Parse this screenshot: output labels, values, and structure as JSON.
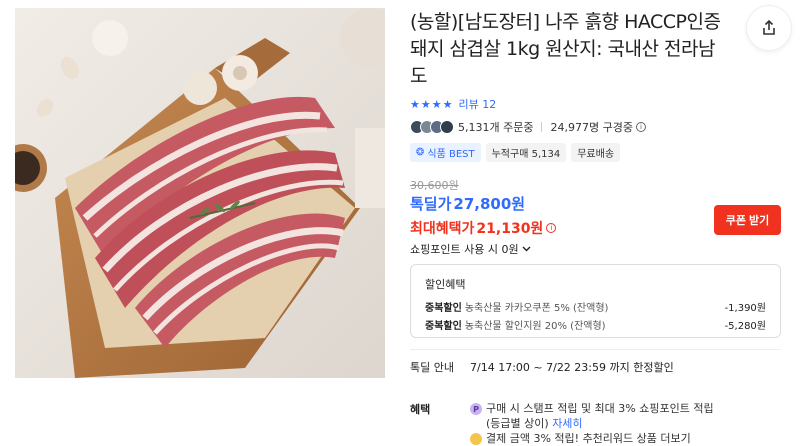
{
  "product": {
    "title": "(농할)[남도장터] 나주 흙향 HACCP인증 돼지 삼겹살 1kg 원산지: 국내산 전라남도"
  },
  "rating": {
    "stars": 4,
    "review_label": "리뷰 12"
  },
  "social": {
    "orders": "5,131개 주문중",
    "watchers": "24,977명 구경중"
  },
  "tags": [
    {
      "label": "식품 BEST"
    },
    {
      "label": "누적구매 5,134"
    },
    {
      "label": "무료배송"
    }
  ],
  "price": {
    "original": "30,600원",
    "deal_label": "톡딜가",
    "deal_price": "27,800원",
    "max_label": "최대혜택가",
    "max_price": "21,130원",
    "coupon_button": "쿠폰 받기",
    "points": "쇼핑포인트 사용 시 0원"
  },
  "discount": {
    "title": "할인혜택",
    "rows": [
      {
        "kind": "중복할인",
        "desc": "농축산물 카카오쿠폰 5% (잔액형)",
        "value": "-1,390원"
      },
      {
        "kind": "중복할인",
        "desc": "농축산물 할인지원 20% (잔액형)",
        "value": "-5,280원"
      }
    ]
  },
  "deal_info": {
    "label": "톡딜 안내",
    "value": "7/14 17:00 ~ 7/22 23:59 까지 한정할인"
  },
  "benefit": {
    "label": "혜택",
    "line1": "구매 시 스탬프 적립 및 최대 3% 쇼핑포인트 적립",
    "line1b": "(등급별 상이)",
    "line1_link": "자세히",
    "line2": "결제 금액 3% 적립! 추천리워드 상품 더보기"
  },
  "colors": {
    "accent_blue": "#2f6bff",
    "accent_red": "#f0321f"
  }
}
